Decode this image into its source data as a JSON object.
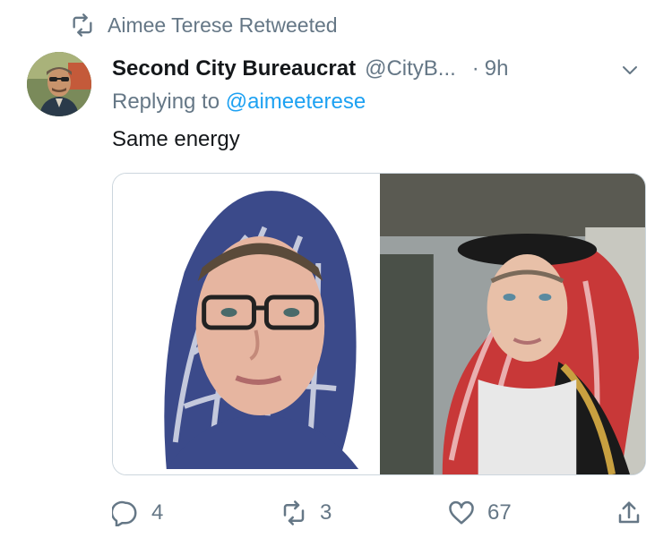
{
  "retweet": {
    "label": "Aimee Terese Retweeted",
    "icon": "retweet-icon"
  },
  "tweet": {
    "display_name": "Second City Bureaucrat",
    "handle": "@CityB...",
    "separator": "·",
    "time": "9h",
    "reply_prefix": "Replying to",
    "reply_to": "@aimeeterese",
    "text": "Same energy",
    "media": [
      {
        "description": "photo-woman-patterned-headscarf"
      },
      {
        "description": "photo-man-red-white-keffiyeh"
      }
    ]
  },
  "actions": {
    "reply_count": "4",
    "retweet_count": "3",
    "like_count": "67"
  },
  "colors": {
    "secondary_text": "#657786",
    "link": "#1da1f2",
    "primary_text": "#14171a",
    "border": "#ccd6dd"
  }
}
